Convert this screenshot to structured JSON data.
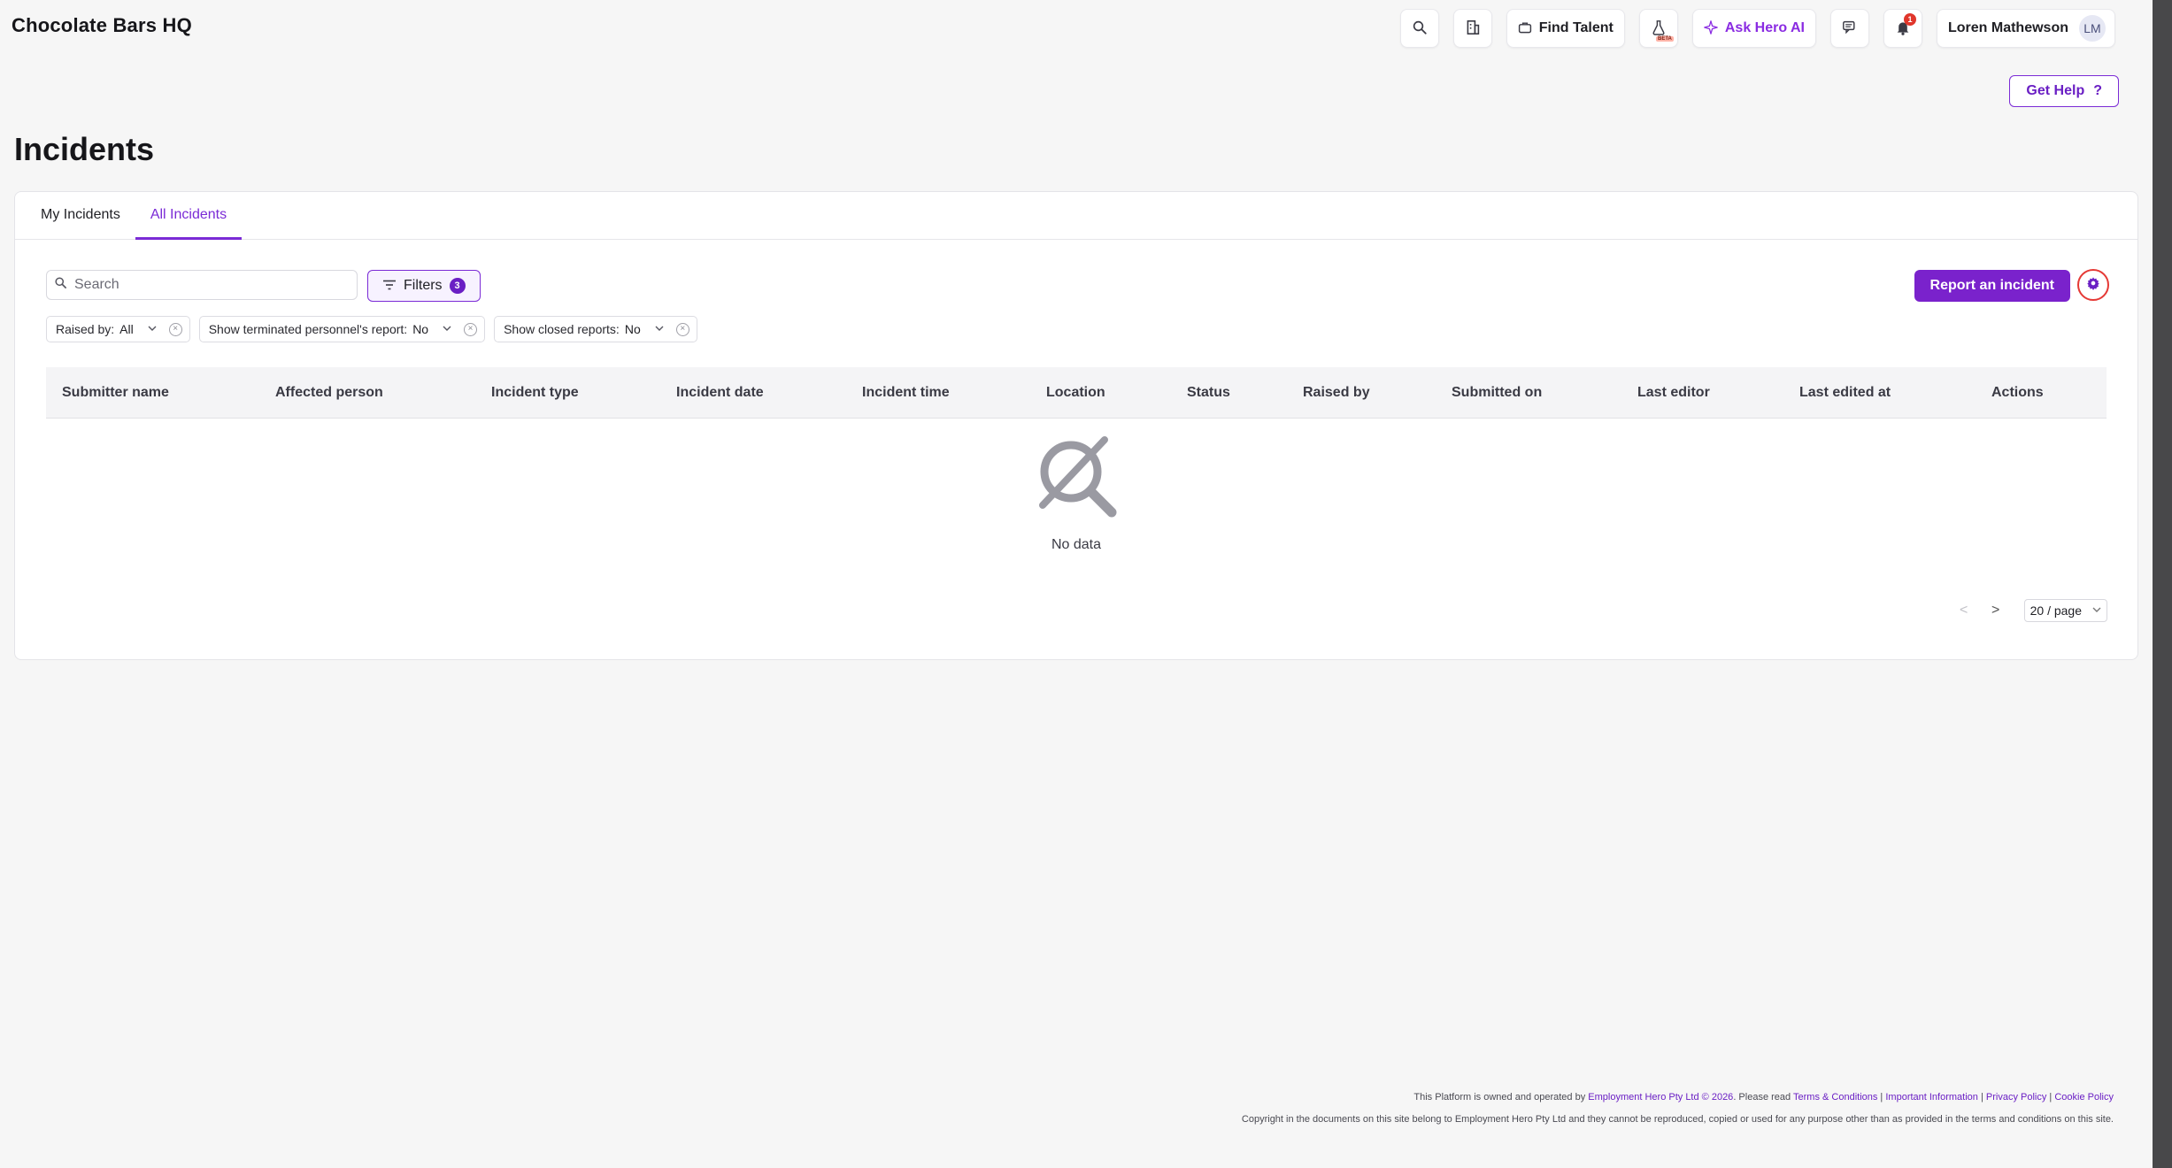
{
  "header": {
    "brand": "Chocolate Bars HQ",
    "find_talent": "Find Talent",
    "ask_ai": "Ask Hero AI",
    "notification_count": "1",
    "beta_label": "BETA",
    "user_name": "Loren Mathewson",
    "user_initials": "LM"
  },
  "help": {
    "label": "Get Help",
    "glyph": "?"
  },
  "page": {
    "title": "Incidents"
  },
  "tabs": [
    {
      "label": "My Incidents",
      "active": false
    },
    {
      "label": "All Incidents",
      "active": true
    }
  ],
  "toolbar": {
    "search_placeholder": "Search",
    "filters_label": "Filters",
    "filters_count": "3",
    "report_label": "Report an incident"
  },
  "chips": [
    {
      "label": "Raised by:",
      "value": "All"
    },
    {
      "label": "Show terminated personnel's report:",
      "value": "No"
    },
    {
      "label": "Show closed reports:",
      "value": "No"
    }
  ],
  "table": {
    "columns": [
      "Submitter name",
      "Affected person",
      "Incident type",
      "Incident date",
      "Incident time",
      "Location",
      "Status",
      "Raised by",
      "Submitted on",
      "Last editor",
      "Last edited at",
      "Actions"
    ],
    "empty_text": "No data"
  },
  "pagination": {
    "prev": "<",
    "next": ">",
    "page_size": "20 / page"
  },
  "footer": {
    "line1_prefix": "This Platform is owned and operated by",
    "owner_link": "Employment Hero Pty Ltd © 2026",
    "line1_mid": ". Please read",
    "terms": "Terms & Conditions",
    "important": "Important Information",
    "privacy": "Privacy Policy",
    "cookie": "Cookie Policy",
    "copyright": "Copyright in the documents on this site belong to Employment Hero Pty Ltd and they cannot be reproduced, copied or used for any purpose other than as provided in the terms and conditions on this site."
  },
  "colors": {
    "accent": "#7b2bd6",
    "primary_button": "#7a22cc",
    "highlight_ring": "#e53935",
    "notification": "#e0362b"
  },
  "icons": {
    "search": "search-icon",
    "company": "building-icon",
    "talent": "briefcase-icon",
    "beta": "flask-icon",
    "ai": "sparkle-icon",
    "chat": "chat-icon",
    "bell": "bell-icon",
    "filter": "filter-icon",
    "settings": "gear-icon",
    "empty": "no-results-icon"
  }
}
